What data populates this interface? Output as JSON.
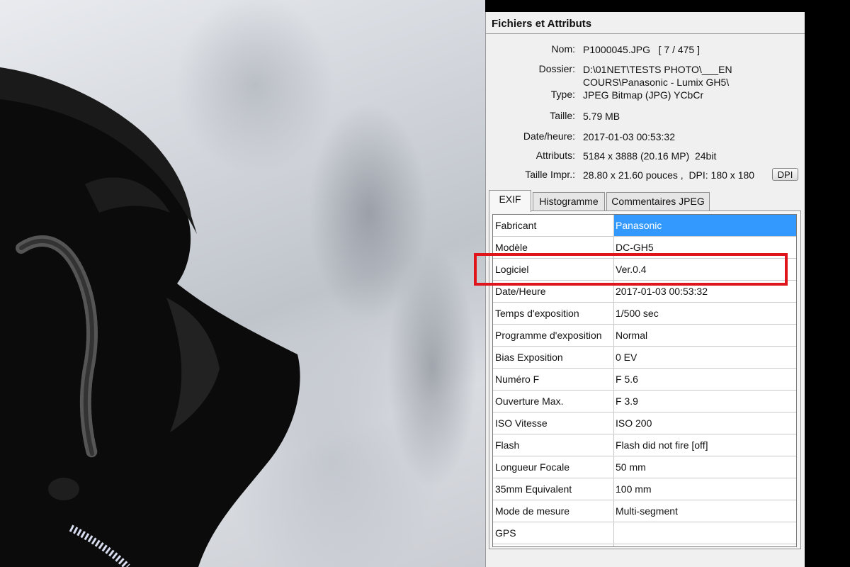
{
  "panel": {
    "title": "Fichiers et Attributs",
    "file_info": [
      {
        "label": "Nom:",
        "value": "P1000045.JPG   [ 7 / 475 ]"
      },
      {
        "label": "Dossier:",
        "value": "D:\\01NET\\TESTS PHOTO\\___EN"
      },
      {
        "label": "",
        "value": "COURS\\Panasonic - Lumix GH5\\"
      },
      {
        "label": "Type:",
        "value": "JPEG Bitmap (JPG) YCbCr"
      },
      {
        "label": "Taille:",
        "value": "5.79 MB"
      },
      {
        "label": "Date/heure:",
        "value": "2017-01-03 00:53:32"
      },
      {
        "label": "Attributs:",
        "value": "5184 x 3888 (20.16 MP)  24bit"
      },
      {
        "label": "Taille Impr.:",
        "value": "28.80 x 21.60 pouces ,  DPI: 180 x 180"
      }
    ],
    "dpi_button": "DPI"
  },
  "tabs": [
    {
      "label": "EXIF",
      "active": true
    },
    {
      "label": "Histogramme",
      "active": false
    },
    {
      "label": "Commentaires JPEG",
      "active": false
    }
  ],
  "exif_rows": [
    {
      "key": "Fabricant",
      "value": "Panasonic",
      "selected": true
    },
    {
      "key": "Modèle",
      "value": "DC-GH5"
    },
    {
      "key": "Logiciel",
      "value": "Ver.0.4"
    },
    {
      "key": "Date/Heure",
      "value": "2017-01-03 00:53:32"
    },
    {
      "key": "Temps d'exposition",
      "value": "1/500 sec"
    },
    {
      "key": "Programme d'exposition",
      "value": "Normal"
    },
    {
      "key": "Bias Exposition",
      "value": "0 EV"
    },
    {
      "key": "Numéro F",
      "value": "F 5.6"
    },
    {
      "key": "Ouverture Max.",
      "value": "F 3.9"
    },
    {
      "key": "ISO Vitesse",
      "value": "ISO 200"
    },
    {
      "key": "Flash",
      "value": "Flash did not fire [off]"
    },
    {
      "key": "Longueur Focale",
      "value": "50 mm"
    },
    {
      "key": "35mm Equivalent",
      "value": "100 mm"
    },
    {
      "key": "Mode de mesure",
      "value": "Multi-segment"
    },
    {
      "key": "GPS",
      "value": ""
    }
  ],
  "colors": {
    "selection": "#3399ff",
    "highlight": "#e0141b"
  }
}
